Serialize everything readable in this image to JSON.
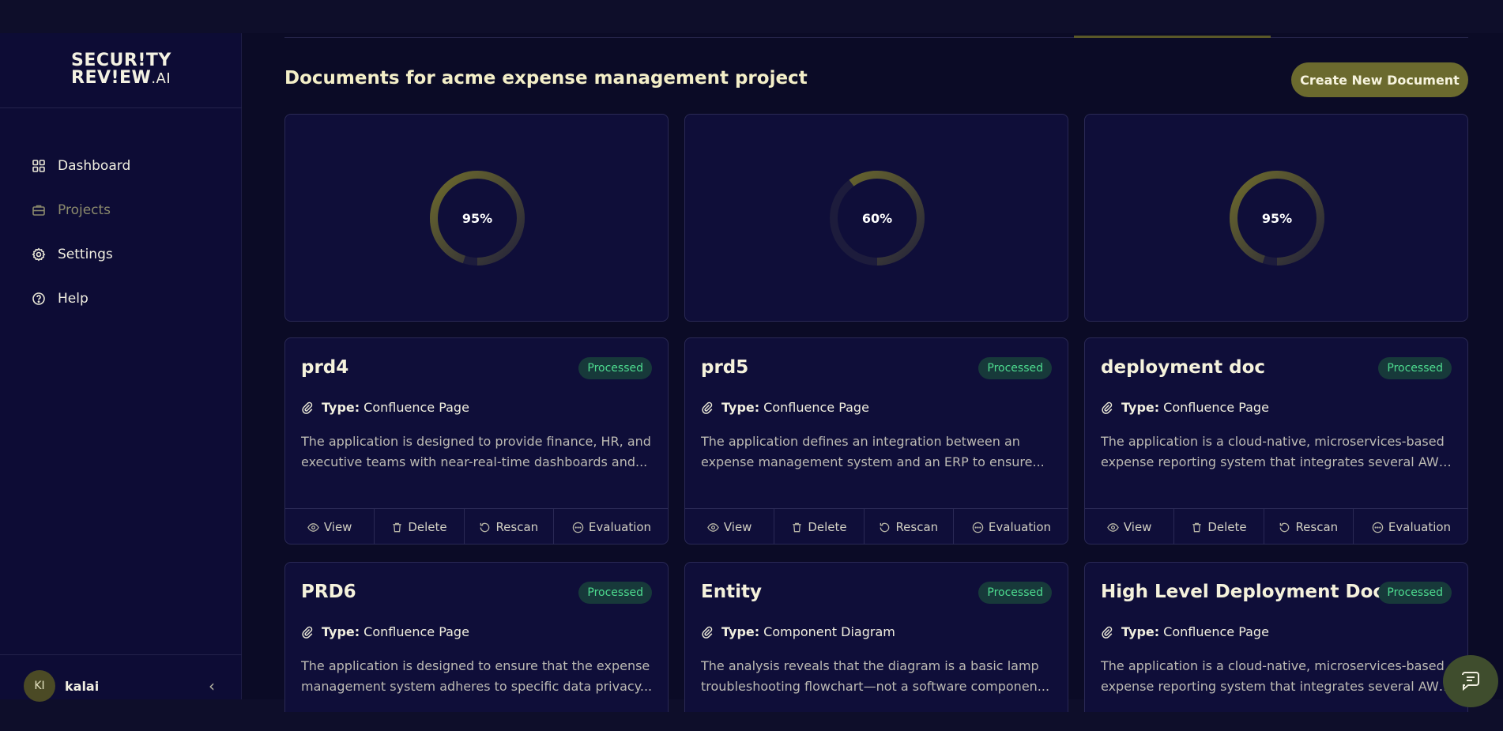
{
  "sidebar": {
    "logo_line1": "SECUR!TY",
    "logo_line2": "REV!EW",
    "logo_suffix": ".AI",
    "items": [
      {
        "label": "Dashboard",
        "icon": "grid-icon"
      },
      {
        "label": "Projects",
        "icon": "briefcase-icon"
      },
      {
        "label": "Settings",
        "icon": "gear-icon"
      },
      {
        "label": "Help",
        "icon": "help-circle-icon"
      }
    ],
    "user": {
      "initials": "KI",
      "name": "kalai"
    },
    "collapse_icon": "‹"
  },
  "main": {
    "title": "Documents for acme expense management project",
    "create_button": "Create New Document",
    "scores": [
      "95%",
      "60%",
      "95%"
    ],
    "score_values": [
      0.95,
      0.6,
      0.95
    ],
    "actions": [
      "View",
      "Delete",
      "Rescan",
      "Evaluation"
    ],
    "type_label": "Type:",
    "documents": [
      {
        "title": "prd4",
        "status": "Processed",
        "type": "Confluence Page",
        "desc1": "The application is designed to provide finance, HR, and",
        "desc2": "executive teams with near-real-time dashboards and..."
      },
      {
        "title": "prd5",
        "status": "Processed",
        "type": "Confluence Page",
        "desc1": "The application defines an integration between an",
        "desc2": "expense management system and an ERP to ensure..."
      },
      {
        "title": "deployment doc",
        "status": "Processed",
        "type": "Confluence Page",
        "desc1": "The application is a cloud-native, microservices-based",
        "desc2": "expense reporting system that integrates several AWS..."
      },
      {
        "title": "PRD6",
        "status": "Processed",
        "type": "Confluence Page",
        "desc1": "The application is designed to ensure that the expense",
        "desc2": "management system adheres to specific data privacy..."
      },
      {
        "title": "Entity",
        "status": "Processed",
        "type": "Component Diagram",
        "desc1": "The analysis reveals that the diagram is a basic lamp",
        "desc2": "troubleshooting flowchart—not a software componen..."
      },
      {
        "title": "High Level Deployment Doc",
        "status": "Processed",
        "type": "Confluence Page",
        "desc1": "The application is a cloud-native, microservices-based",
        "desc2": "expense reporting system that integrates several AWS..."
      }
    ]
  },
  "colors": {
    "accent": "#6b6a2e",
    "badge_bg": "#17393a",
    "badge_text": "#4ddb8f",
    "ring_track": "#1d1c3c"
  }
}
